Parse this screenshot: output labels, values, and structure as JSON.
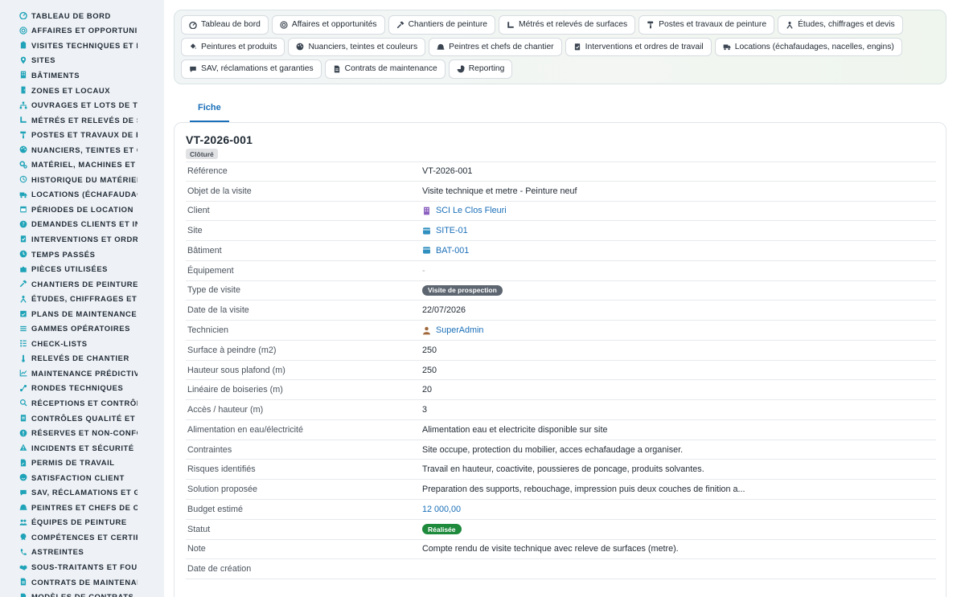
{
  "theme": {
    "accent": "#1a6fb8",
    "sidebar_bg": "#eef1f5",
    "icon_color": "#1fa3b8",
    "success": "#1e8a3c",
    "status_grey": "#5c6570"
  },
  "sidebar": {
    "items": [
      {
        "label": "TABLEAU DE BORD",
        "icon": "dashboard-icon"
      },
      {
        "label": "AFFAIRES ET OPPORTUNITÉS",
        "icon": "target-icon"
      },
      {
        "label": "VISITES TECHNIQUES ET MÉTRÉS",
        "icon": "clipboard-icon"
      },
      {
        "label": "SITES",
        "icon": "map-pin-icon"
      },
      {
        "label": "BÂTIMENTS",
        "icon": "building-icon"
      },
      {
        "label": "ZONES ET LOCAUX",
        "icon": "door-icon"
      },
      {
        "label": "OUVRAGES ET LOTS DE TRAVAUX",
        "icon": "sitemap-icon"
      },
      {
        "label": "MÉTRÉS ET RELEVÉS DE SURFACES",
        "icon": "ruler-icon"
      },
      {
        "label": "POSTES ET TRAVAUX DE PEINTURE",
        "icon": "paint-roller-icon"
      },
      {
        "label": "NUANCIERS, TEINTES ET COULEURS",
        "icon": "palette-icon"
      },
      {
        "label": "MATÉRIEL, MACHINES ET OUTILLAGE",
        "icon": "cogs-icon"
      },
      {
        "label": "HISTORIQUE DU MATÉRIEL",
        "icon": "history-icon"
      },
      {
        "label": "LOCATIONS (ÉCHAFAUDAGES, NACELLES)",
        "icon": "truck-icon"
      },
      {
        "label": "PÉRIODES DE LOCATION",
        "icon": "calendar-icon"
      },
      {
        "label": "DEMANDES CLIENTS ET INTERVENTIONS",
        "icon": "question-icon"
      },
      {
        "label": "INTERVENTIONS ET ORDRES DE TRAVAIL",
        "icon": "clipboard-check-icon"
      },
      {
        "label": "TEMPS PASSÉS",
        "icon": "clock-icon"
      },
      {
        "label": "PIÈCES UTILISÉES",
        "icon": "puzzle-icon"
      },
      {
        "label": "CHANTIERS DE PEINTURE",
        "icon": "hammer-icon"
      },
      {
        "label": "ÉTUDES, CHIFFRAGES ET DEVIS",
        "icon": "people-icon"
      },
      {
        "label": "PLANS DE MAINTENANCE",
        "icon": "calendar-check-icon"
      },
      {
        "label": "GAMMES OPÉRATOIRES",
        "icon": "list-icon"
      },
      {
        "label": "CHECK-LISTS",
        "icon": "checklist-icon"
      },
      {
        "label": "RELEVÉS DE CHANTIER",
        "icon": "thermometer-icon"
      },
      {
        "label": "MAINTENANCE PRÉDICTIVE",
        "icon": "chart-line-icon"
      },
      {
        "label": "RONDES TECHNIQUES",
        "icon": "route-icon"
      },
      {
        "label": "RÉCEPTIONS ET CONTRÔLES",
        "icon": "search-icon"
      },
      {
        "label": "CONTRÔLES QUALITÉ ET CONFORMITÉ",
        "icon": "clipboard-list-icon"
      },
      {
        "label": "RÉSERVES ET NON-CONFORMITÉS",
        "icon": "alert-circle-icon"
      },
      {
        "label": "INCIDENTS ET SÉCURITÉ",
        "icon": "warning-icon"
      },
      {
        "label": "PERMIS DE TRAVAIL",
        "icon": "file-signature-icon"
      },
      {
        "label": "SATISFACTION CLIENT",
        "icon": "smile-icon"
      },
      {
        "label": "SAV, RÉCLAMATIONS ET GARANTIES",
        "icon": "comment-icon"
      },
      {
        "label": "PEINTRES ET CHEFS DE CHANTIER",
        "icon": "hard-hat-icon"
      },
      {
        "label": "ÉQUIPES DE PEINTURE",
        "icon": "users-icon"
      },
      {
        "label": "COMPÉTENCES ET CERTIFICATIONS",
        "icon": "certificate-icon"
      },
      {
        "label": "ASTREINTES",
        "icon": "phone-icon"
      },
      {
        "label": "SOUS-TRAITANTS ET FOURNISSEURS",
        "icon": "handshake-icon"
      },
      {
        "label": "CONTRATS DE MAINTENANCE",
        "icon": "contract-icon"
      },
      {
        "label": "MODÈLES DE CONTRATS",
        "icon": "file-icon"
      }
    ]
  },
  "quick_links": [
    {
      "label": "Tableau de bord",
      "icon": "dashboard-icon"
    },
    {
      "label": "Affaires et opportunités",
      "icon": "target-icon"
    },
    {
      "label": "Chantiers de peinture",
      "icon": "hammer-icon"
    },
    {
      "label": "Métrés et relevés de surfaces",
      "icon": "ruler-icon"
    },
    {
      "label": "Postes et travaux de peinture",
      "icon": "paint-roller-icon"
    },
    {
      "label": "Études, chiffrages et devis",
      "icon": "people-icon"
    },
    {
      "label": "Peintures et produits",
      "icon": "paint-bucket-icon"
    },
    {
      "label": "Nuanciers, teintes et couleurs",
      "icon": "palette-icon"
    },
    {
      "label": "Peintres et chefs de chantier",
      "icon": "hard-hat-icon"
    },
    {
      "label": "Interventions et ordres de travail",
      "icon": "clipboard-check-icon"
    },
    {
      "label": "Locations (échafaudages, nacelles, engins)",
      "icon": "truck-icon"
    },
    {
      "label": "SAV, réclamations et garanties",
      "icon": "comment-icon"
    },
    {
      "label": "Contrats de maintenance",
      "icon": "contract-icon"
    },
    {
      "label": "Reporting",
      "icon": "pie-chart-icon"
    }
  ],
  "tabs": [
    {
      "label": "Fiche",
      "active": true
    }
  ],
  "record": {
    "title": "VT-2026-001",
    "status_badge": "Clôturé",
    "fields": [
      {
        "label": "Référence",
        "value": "VT-2026-001",
        "kind": "text"
      },
      {
        "label": "Objet de la visite",
        "value": "Visite technique et metre - Peinture neuf",
        "kind": "text"
      },
      {
        "label": "Client",
        "value": "SCI Le Clos Fleuri",
        "kind": "link",
        "icon": "building-icon"
      },
      {
        "label": "Site",
        "value": "SITE-01",
        "kind": "link",
        "icon": "box-icon"
      },
      {
        "label": "Bâtiment",
        "value": "BAT-001",
        "kind": "link",
        "icon": "box-icon"
      },
      {
        "label": "Équipement",
        "value": "-",
        "kind": "muted"
      },
      {
        "label": "Type de visite",
        "value": "Visite de prospection",
        "kind": "pill-grey"
      },
      {
        "label": "Date de la visite",
        "value": "22/07/2026",
        "kind": "text"
      },
      {
        "label": "Technicien",
        "value": "SuperAdmin",
        "kind": "link",
        "icon": "user-icon"
      },
      {
        "label": "Surface à peindre (m2)",
        "value": "250",
        "kind": "text"
      },
      {
        "label": "Hauteur sous plafond (m)",
        "value": "250",
        "kind": "text"
      },
      {
        "label": "Linéaire de boiseries (m)",
        "value": "20",
        "kind": "text"
      },
      {
        "label": "Accès / hauteur (m)",
        "value": "3",
        "kind": "text"
      },
      {
        "label": "Alimentation en eau/électricité",
        "value": "Alimentation eau et electricite disponible sur site",
        "kind": "text"
      },
      {
        "label": "Contraintes",
        "value": "Site occupe, protection du mobilier, acces echafaudage a organiser.",
        "kind": "text"
      },
      {
        "label": "Risques identifiés",
        "value": "Travail en hauteur, coactivite, poussieres de poncage, produits solvantes.",
        "kind": "text"
      },
      {
        "label": "Solution proposée",
        "value": "Preparation des supports, rebouchage, impression puis deux couches de finition a...",
        "kind": "text"
      },
      {
        "label": "Budget estimé",
        "value": "12 000,00",
        "kind": "link"
      },
      {
        "label": "Statut",
        "value": "Réalisée",
        "kind": "pill-green"
      },
      {
        "label": "Note",
        "value": "Compte rendu de visite technique avec releve de surfaces (metre).",
        "kind": "text"
      },
      {
        "label": "Date de création",
        "value": "",
        "kind": "text"
      }
    ]
  }
}
